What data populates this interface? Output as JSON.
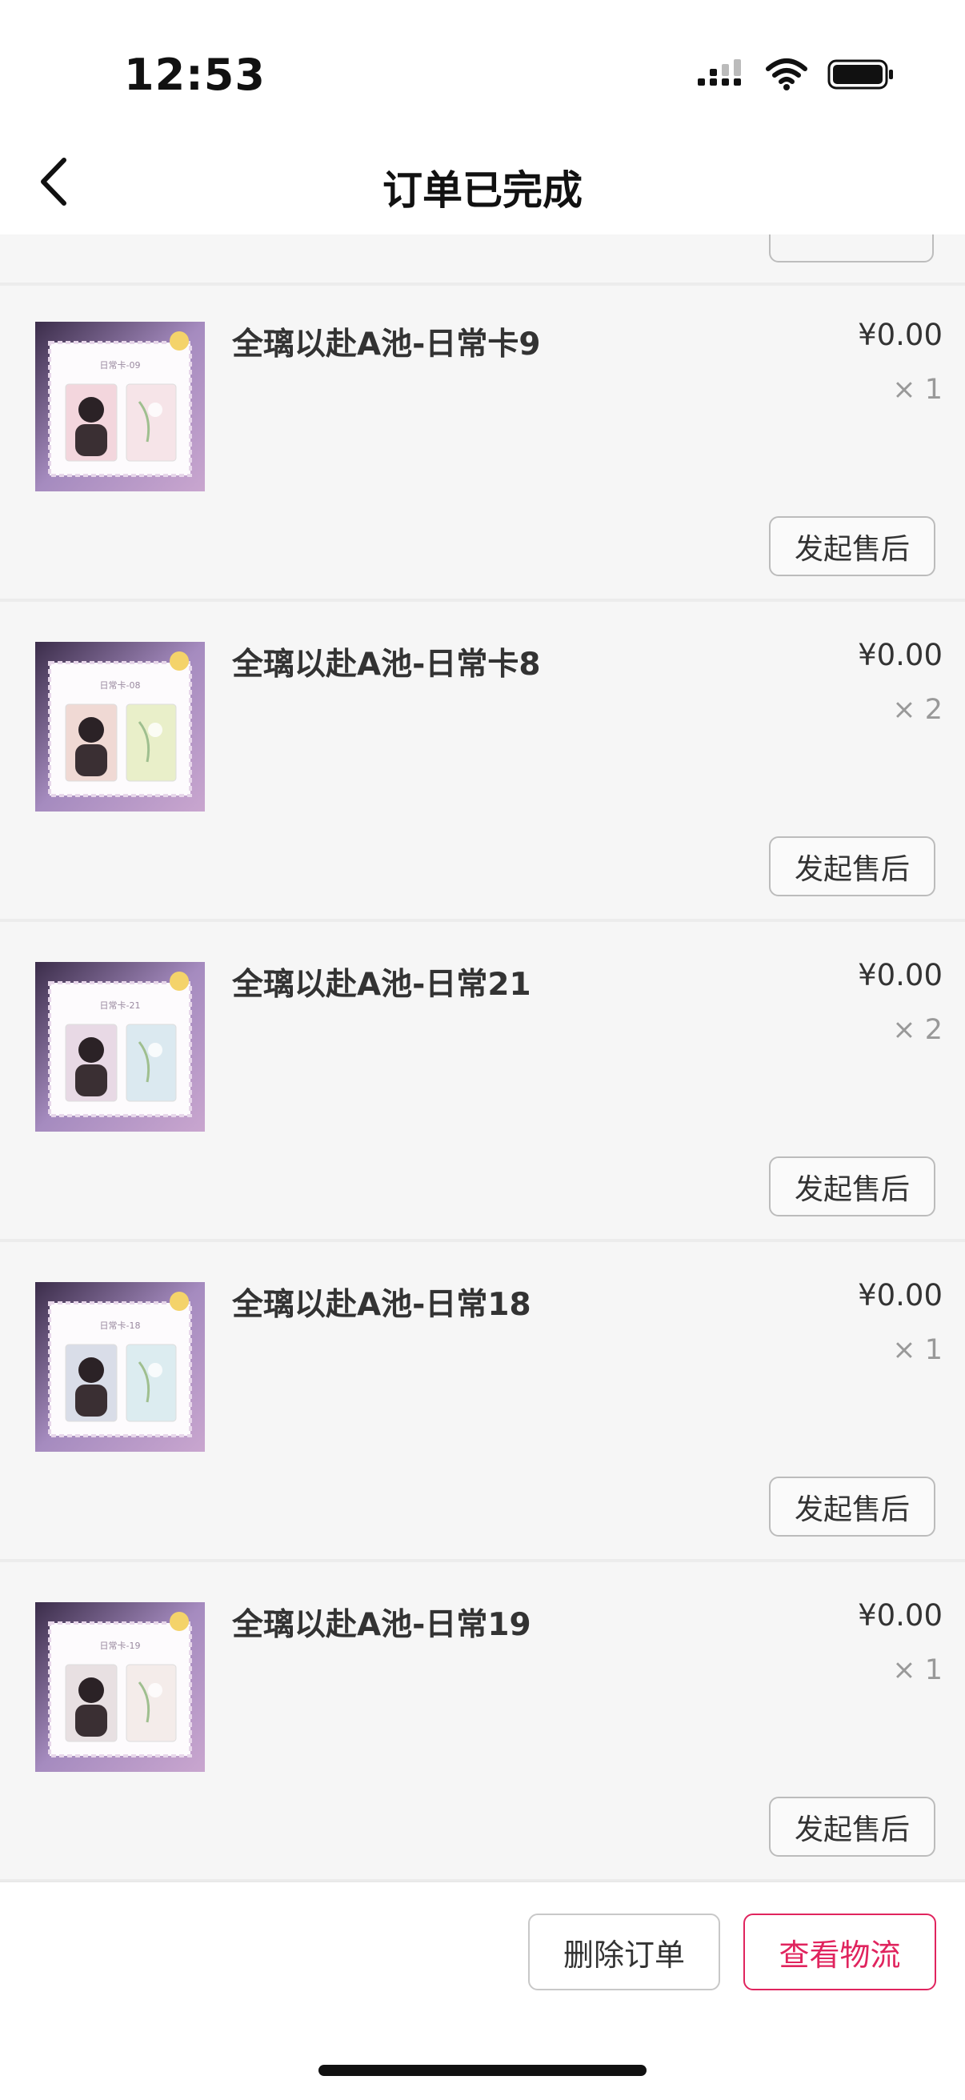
{
  "status_bar": {
    "time": "12:53",
    "icons": [
      "signal-icon",
      "wifi-icon",
      "battery-icon"
    ]
  },
  "nav": {
    "title": "订单已完成",
    "back_icon": "chevron-left-icon"
  },
  "partial_button_label": "发起售后",
  "items": [
    {
      "title": "全璃以赴A池-日常卡9",
      "thumb_label": "日常卡-09",
      "price": "¥0.00",
      "qty": "× 1",
      "button": "发起售后",
      "thumb_colors": [
        "#f3d6dd",
        "#f6e4e8"
      ]
    },
    {
      "title": "全璃以赴A池-日常卡8",
      "thumb_label": "日常卡-08",
      "price": "¥0.00",
      "qty": "× 2",
      "button": "发起售后",
      "thumb_colors": [
        "#f0d9d4",
        "#e9efc9"
      ]
    },
    {
      "title": "全璃以赴A池-日常21",
      "thumb_label": "日常卡-21",
      "price": "¥0.00",
      "qty": "× 2",
      "button": "发起售后",
      "thumb_colors": [
        "#e8d9e5",
        "#dbe9f0"
      ]
    },
    {
      "title": "全璃以赴A池-日常18",
      "thumb_label": "日常卡-18",
      "price": "¥0.00",
      "qty": "× 1",
      "button": "发起售后",
      "thumb_colors": [
        "#d9dde8",
        "#dcecf0"
      ]
    },
    {
      "title": "全璃以赴A池-日常19",
      "thumb_label": "日常卡-19",
      "price": "¥0.00",
      "qty": "× 1",
      "button": "发起售后",
      "thumb_colors": [
        "#e8e0e2",
        "#f4ecea"
      ]
    }
  ],
  "bottom": {
    "delete_label": "删除订单",
    "logistics_label": "查看物流"
  },
  "colors": {
    "accent": "#e0245e",
    "background": "#f6f6f6",
    "thumb_border": "#8e6aa5"
  }
}
